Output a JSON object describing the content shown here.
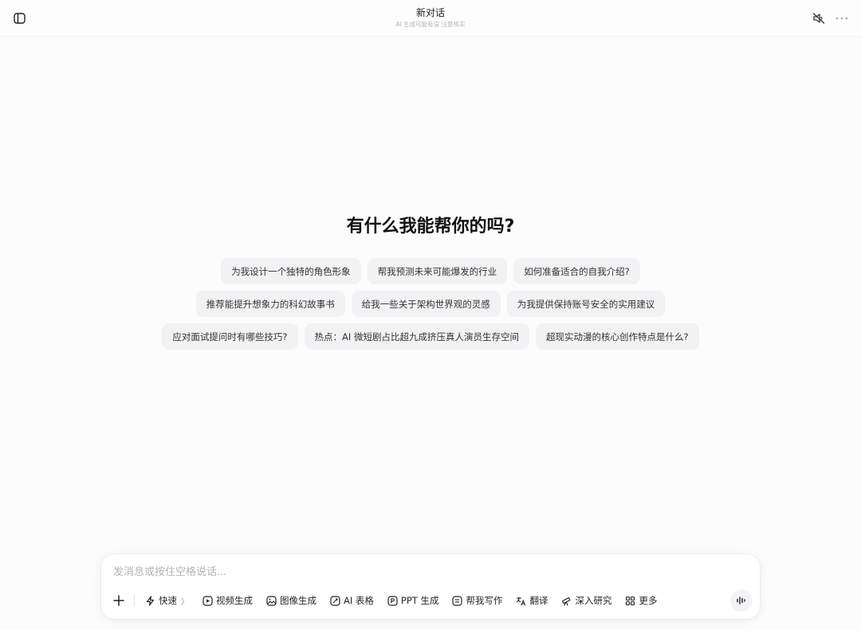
{
  "header": {
    "title": "新对话",
    "subtitle": "AI 生成可能有误 注意核实",
    "icons": {
      "sidebar_toggle": "sidebar-toggle-icon",
      "mute": "speaker-muted-icon",
      "more": "ellipsis-icon"
    }
  },
  "main": {
    "heading": "有什么我能帮你的吗?",
    "suggestions": [
      [
        "为我设计一个独特的角色形象",
        "帮我预测未来可能爆发的行业",
        "如何准备适合的自我介绍?"
      ],
      [
        "推荐能提升想象力的科幻故事书",
        "给我一些关于架构世界观的灵感",
        "为我提供保持账号安全的实用建议"
      ],
      [
        "应对面试提问时有哪些技巧?",
        "热点：AI 微短剧占比超九成挤压真人演员生存空间",
        "超现实动漫的核心创作特点是什么?"
      ]
    ]
  },
  "composer": {
    "placeholder": "发消息或按住空格说话...",
    "value": "",
    "tools": [
      {
        "label": "快速",
        "icon": "lightning-icon",
        "has_chevron": true
      },
      {
        "label": "视频生成",
        "icon": "video-icon"
      },
      {
        "label": "图像生成",
        "icon": "image-icon"
      },
      {
        "label": "AI 表格",
        "icon": "table-icon"
      },
      {
        "label": "PPT 生成",
        "icon": "ppt-icon"
      },
      {
        "label": "帮我写作",
        "icon": "write-icon"
      },
      {
        "label": "翻译",
        "icon": "translate-icon"
      },
      {
        "label": "深入研究",
        "icon": "telescope-icon"
      },
      {
        "label": "更多",
        "icon": "grid-icon"
      }
    ],
    "chevron": "〉",
    "voice_icon": "voice-waveform-icon"
  }
}
